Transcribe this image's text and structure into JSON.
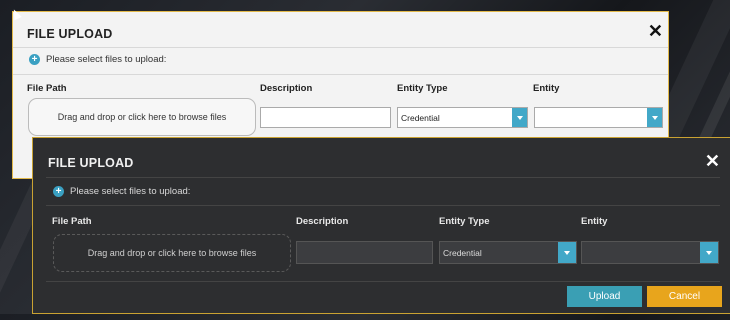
{
  "dialog": {
    "title": "FILE UPLOAD",
    "info": "Please select files to upload:",
    "columns": {
      "file_path": "File Path",
      "description": "Description",
      "entity_type": "Entity Type",
      "entity": "Entity"
    },
    "dropzone_text": "Drag and drop or click here to browse files",
    "description_value": "",
    "entity_type_value": "Credential",
    "entity_value": "",
    "close_icon": "close-icon",
    "add_icon": "plus-circle-icon"
  },
  "buttons": {
    "upload": "Upload",
    "cancel": "Cancel"
  },
  "colors": {
    "accent_teal": "#3a9fb4",
    "cancel_orange": "#e8a51c",
    "border_gold": "#c9a232"
  }
}
